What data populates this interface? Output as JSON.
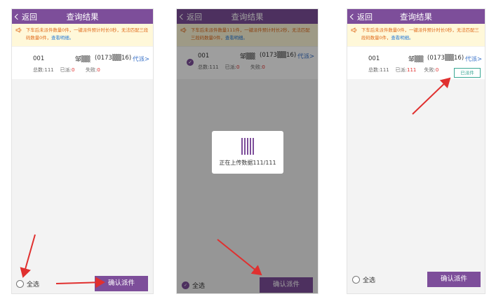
{
  "panel1": {
    "header": {
      "back_label": "返回",
      "title": "查询结果"
    },
    "notice": {
      "text": "下车后未派件数量0件，一键派件预计时长0秒，无法匹配三段码数量0件，",
      "link": "查看明细。"
    },
    "record": {
      "number": "001",
      "name": "邹▒▒",
      "phone": "(0173▒▒16)",
      "agent_link": "代派>",
      "stats": {
        "total_label": "总数:",
        "total": "111",
        "done_label": "已派:",
        "done": "0",
        "fail_label": "失败:",
        "fail": "0"
      }
    },
    "footer": {
      "select_all": "全选",
      "confirm": "确认派件"
    }
  },
  "panel2": {
    "header": {
      "back_label": "返回",
      "title": "查询结果"
    },
    "notice": {
      "text": "下车后未派件数量111件，一键派件预计时长2秒，无法匹配三段码数量0件，",
      "link": "查看明细。"
    },
    "record": {
      "number": "001",
      "name": "邹▒▒",
      "phone": "(0173▒▒16)",
      "agent_link": "代派>",
      "stats": {
        "total_label": "总数:",
        "total": "111",
        "done_label": "已派:",
        "done": "0",
        "fail_label": "失败:",
        "fail": "0"
      }
    },
    "toast": {
      "message": "正在上传数据111/111"
    },
    "footer": {
      "select_all": "全选",
      "confirm": "确认派件"
    }
  },
  "panel3": {
    "header": {
      "back_label": "返回",
      "title": "查询结果"
    },
    "notice": {
      "text": "下车后未派件数量0件，一键派件预计时长0秒，无法匹配三段码数量0件，",
      "link": "查看明细。"
    },
    "record": {
      "number": "001",
      "name": "邹▒▒",
      "phone": "(0173▒▒16)",
      "agent_link": "代派>",
      "stats": {
        "total_label": "总数:",
        "total": "111",
        "done_label": "已派:",
        "done": "111",
        "fail_label": "失败:",
        "fail": "0"
      },
      "badge": "已派件"
    },
    "footer": {
      "select_all": "全选",
      "confirm": "确认派件"
    }
  },
  "colors": {
    "brand_purple": "#7d4e9a",
    "notice_bg": "#fff8d9",
    "notice_text": "#e06a1a",
    "link_blue": "#3b73c9",
    "arrow_red": "#e0302f",
    "badge_green": "#3aa894"
  }
}
